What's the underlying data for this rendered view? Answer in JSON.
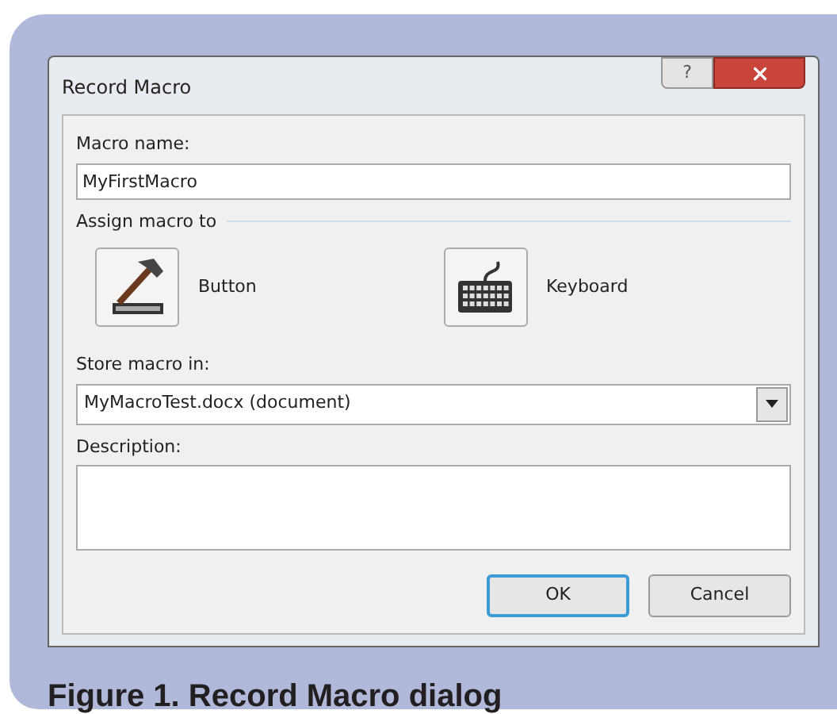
{
  "window": {
    "title": "Record Macro",
    "help_button": "?"
  },
  "macro_name": {
    "label": "Macro name:",
    "value": "MyFirstMacro"
  },
  "assign": {
    "heading": "Assign macro to",
    "options": [
      {
        "kind": "button",
        "label": "Button"
      },
      {
        "kind": "keyboard",
        "label": "Keyboard"
      }
    ]
  },
  "store": {
    "label": "Store macro in:",
    "value": "MyMacroTest.docx (document)"
  },
  "description": {
    "label": "Description:"
  },
  "buttons": [
    {
      "label": "OK",
      "default": true
    },
    {
      "label": "Cancel",
      "default": false
    }
  ],
  "caption": "Figure 1. Record Macro dialog"
}
